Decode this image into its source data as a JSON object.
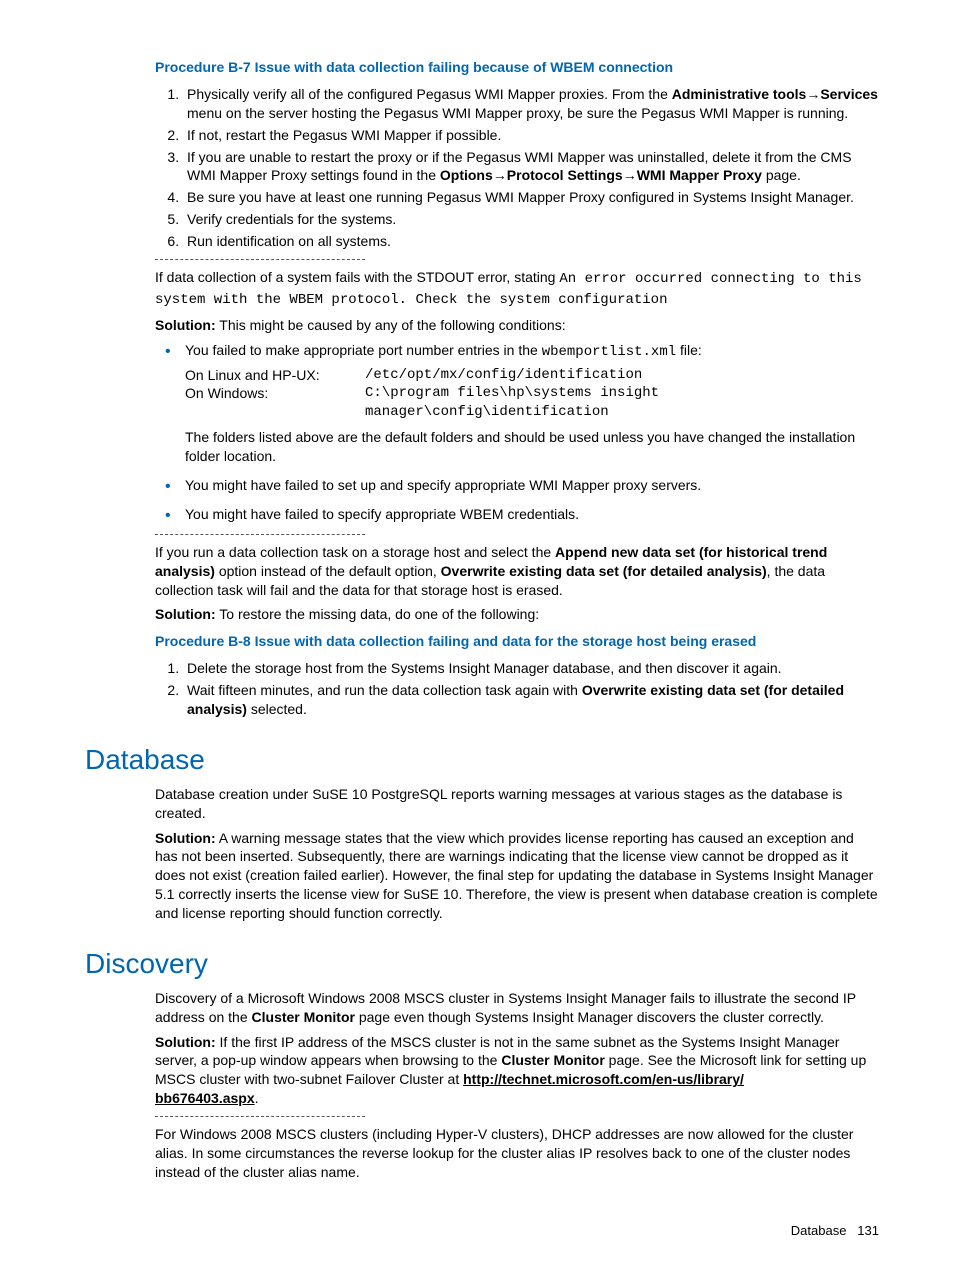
{
  "proc7": {
    "title": "Procedure B-7 Issue with data collection failing because of WBEM connection",
    "steps": {
      "s1a": "Physically verify all of the configured Pegasus WMI Mapper proxies. From the ",
      "s1b": "Administrative tools",
      "s1arrow": "→",
      "s1c": "Services",
      "s1d": " menu on the server hosting the Pegasus WMI Mapper proxy, be sure the Pegasus WMI Mapper is running.",
      "s2": "If not, restart the Pegasus WMI Mapper if possible.",
      "s3a": "If you are unable to restart the proxy or if the Pegasus WMI Mapper was uninstalled, delete it from the CMS WMI Mapper Proxy settings found in the ",
      "s3b": "Options",
      "s3c": "Protocol Settings",
      "s3d": "WMI Mapper Proxy",
      "s3e": " page.",
      "s4": "Be sure you have at least one running Pegasus WMI Mapper Proxy configured in Systems Insight Manager.",
      "s5": "Verify credentials for the systems.",
      "s6": "Run identification on all systems."
    }
  },
  "stdout": {
    "p1a": "If data collection of a system fails with the STDOUT error, stating ",
    "p1b": "An error occurred connecting to this system with the WBEM protocol. Check the system configuration",
    "sol_label": "Solution:",
    "sol_text": " This might be caused by any of the following conditions:",
    "b1a": "You failed to make appropriate port number entries in the ",
    "b1b": "wbemportlist.xml",
    "b1c": " file:",
    "linux_label": "On Linux and HP-UX:",
    "linux_path": "/etc/opt/mx/config/identification",
    "win_label": "On Windows:",
    "win_path1": "C:\\program files\\hp\\systems insight",
    "win_path2": "manager\\config\\identification",
    "b1_note": "The folders listed above are the default folders and should be used unless you have changed the installation folder location.",
    "b2": "You might have failed to set up and specify appropriate WMI Mapper proxy servers.",
    "b3": "You might have failed to specify appropriate WBEM credentials."
  },
  "append": {
    "p1a": "If you run a data collection task on a storage host and select the ",
    "p1b": "Append new data set (for historical trend analysis)",
    "p1c": " option instead of the default option, ",
    "p1d": "Overwrite existing data set (for detailed analysis)",
    "p1e": ", the data collection task will fail and the data for that storage host is erased.",
    "sol_label": "Solution:",
    "sol_text": " To restore the missing data, do one of the following:"
  },
  "proc8": {
    "title": "Procedure B-8 Issue with data collection failing and data for the storage host being erased",
    "s1": "Delete the storage host from the Systems Insight Manager database, and then discover it again.",
    "s2a": "Wait fifteen minutes, and run the data collection task again with ",
    "s2b": "Overwrite existing data set (for detailed analysis)",
    "s2c": " selected."
  },
  "database": {
    "heading": "Database",
    "p1": "Database creation under SuSE 10 PostgreSQL reports warning messages at various stages as the database is created.",
    "sol_label": "Solution:",
    "sol_text": " A warning message states that the view which provides license reporting has caused an exception and has not been inserted. Subsequently, there are warnings indicating that the license view cannot be dropped as it does not exist (creation failed earlier). However, the final step for updating the database in Systems Insight Manager 5.1 correctly inserts the license view for SuSE 10. Therefore, the view is present when database creation is complete and license reporting should function correctly."
  },
  "discovery": {
    "heading": "Discovery",
    "p1a": "Discovery of a Microsoft Windows 2008 MSCS cluster in Systems Insight Manager fails to illustrate the second IP address on the ",
    "p1b": "Cluster Monitor",
    "p1c": " page even though Systems Insight Manager discovers the cluster correctly.",
    "sol_label": "Solution:",
    "sol_a": " If the first IP address of the MSCS cluster is not in the same subnet as the Systems Insight Manager server, a pop-up window appears when browsing to the ",
    "sol_b": "Cluster Monitor",
    "sol_c": " page. See the Microsoft link for setting up MSCS cluster with two-subnet Failover Cluster at ",
    "link1": "http://technet.microsoft.com/en-us/library/",
    "link2": "bb676403.aspx",
    "sol_d": ".",
    "p2": "For Windows 2008 MSCS clusters (including Hyper-V clusters), DHCP addresses are now allowed for the cluster alias. In some circumstances the reverse lookup for the cluster alias IP resolves back to one of the cluster nodes instead of the cluster alias name."
  },
  "footer": {
    "label": "Database",
    "page": "131"
  }
}
